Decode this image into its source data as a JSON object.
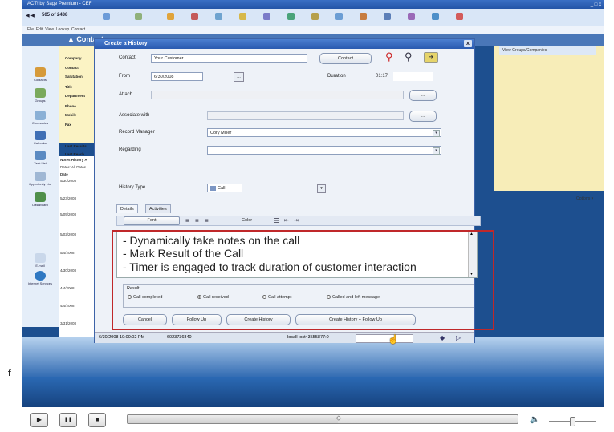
{
  "app": {
    "title": "ACT! by Sage Premium - CEF",
    "window_buttons": "_ □ x",
    "record_counter": "505 of 2438",
    "menu": [
      "File",
      "Edit",
      "View",
      "Lookup",
      "Contact"
    ],
    "contact_tab": "Contact",
    "right_header": "View Groups/Companies",
    "options_label": "Options ▾"
  },
  "left_nav": [
    "Contacts",
    "Groups",
    "Companies",
    "Calendar",
    "Task List",
    "Opportunity List",
    "Dashboard",
    "E-mail",
    "Internet Services"
  ],
  "contact_fields": [
    "Company",
    "Contact",
    "Salutation",
    "Title",
    "Department",
    "Phone",
    "Mobile",
    "Fax",
    "Last Results",
    "Last Reach"
  ],
  "history_tabs": [
    "Notes",
    "History",
    "A"
  ],
  "history_filter": "Dates: All Dates",
  "history_col": "Date",
  "history_dates": [
    "5/30/2008",
    "5/23/2008",
    "5/05/2008",
    "5/02/2008",
    "5/4/2008",
    "4/30/2008",
    "4/4/2008",
    "4/4/2008",
    "3/31/2008"
  ],
  "dialog": {
    "title": "Create a History",
    "contact_label": "Contact",
    "contact_value": "Your Customer",
    "contact_button": "Contact",
    "from_label": "From",
    "from_value": "6/30/2008",
    "duration_label": "Duration",
    "duration_value": "01:17",
    "attach_label": "Attach",
    "attach_button": "...",
    "associate_label": "Associate with",
    "associate_button": "...",
    "record_manager_label": "Record Manager",
    "record_manager_value": "Cory Miller",
    "regarding_label": "Regarding",
    "regarding_value": "",
    "history_type_label": "History Type",
    "history_type_value": "Call",
    "tabs": [
      "Details",
      "Activities"
    ],
    "format": {
      "font_label": "Font",
      "color_label": "Color"
    },
    "notes": [
      "- Dynamically take notes on the call",
      "- Mark Result of the Call",
      "- Timer is engaged to track duration of customer interaction"
    ],
    "result_label": "Result",
    "results": [
      {
        "label": "Call completed",
        "selected": false
      },
      {
        "label": "Call received",
        "selected": true
      },
      {
        "label": "Call attempt",
        "selected": false
      },
      {
        "label": "Called and left message",
        "selected": false
      }
    ],
    "buttons": {
      "cancel": "Cancel",
      "follow_up": "Follow Up",
      "create_history": "Create History",
      "create_history_follow_up": "Create History + Follow Up"
    },
    "status": {
      "timestamp": "6/30/2008 10:00:02 PM",
      "phone": "6023736840",
      "host": "localHost43555877:0"
    }
  },
  "stray_text": "f",
  "player": {
    "play": "▶",
    "pause": "❚❚",
    "stop": "■",
    "volume_icon": "🔈",
    "progress_value": 0.54,
    "volume_value": 0.5
  }
}
